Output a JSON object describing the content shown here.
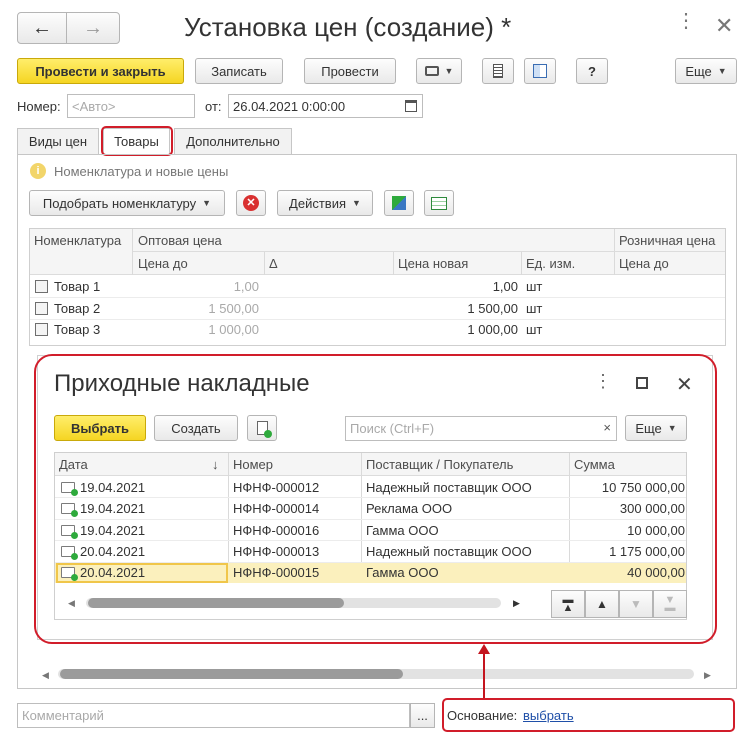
{
  "window": {
    "title": "Установка цен (создание) *"
  },
  "nav": {
    "back_icon": "arrow-left-icon",
    "forward_icon": "arrow-right-icon"
  },
  "toolbar": {
    "post_close": "Провести и закрыть",
    "save": "Записать",
    "post": "Провести",
    "help": "?",
    "more": "Еще"
  },
  "header_fields": {
    "number_label": "Номер:",
    "number_placeholder": "<Авто>",
    "date_label": "от:",
    "date_value": "26.04.2021  0:00:00"
  },
  "tabs": [
    {
      "label": "Виды цен"
    },
    {
      "label": "Товары"
    },
    {
      "label": "Дополнительно"
    }
  ],
  "info_text": "Номенклатура и новые цены",
  "goods_toolbar": {
    "select_items": "Подобрать номенклатуру",
    "actions": "Действия"
  },
  "goods_table": {
    "col_item": "Номенклатура",
    "col_wholesale": "Оптовая цена",
    "col_retail": "Розничная цена",
    "sub_price_before": "Цена до",
    "sub_delta": "Δ",
    "sub_price_new": "Цена новая",
    "sub_unit": "Ед. изм.",
    "sub_retail_before": "Цена до",
    "rows": [
      {
        "name": "Товар 1",
        "before": "1,00",
        "new": "1,00",
        "unit": "шт"
      },
      {
        "name": "Товар 2",
        "before": "1 500,00",
        "new": "1 500,00",
        "unit": "шт"
      },
      {
        "name": "Товар 3",
        "before": "1 000,00",
        "new": "1 000,00",
        "unit": "шт"
      }
    ]
  },
  "popup": {
    "title": "Приходные накладные",
    "choose": "Выбрать",
    "create": "Создать",
    "search_placeholder": "Поиск (Ctrl+F)",
    "clear": "×",
    "more": "Еще",
    "columns": {
      "date": "Дата",
      "sort_arrow": "↓",
      "number": "Номер",
      "counterparty": "Поставщик / Покупатель",
      "sum": "Сумма"
    },
    "rows": [
      {
        "date": "19.04.2021",
        "number": "НФНФ-000012",
        "party": "Надежный поставщик ООО",
        "sum": "10 750 000,00"
      },
      {
        "date": "19.04.2021",
        "number": "НФНФ-000014",
        "party": "Реклама ООО",
        "sum": "300 000,00"
      },
      {
        "date": "19.04.2021",
        "number": "НФНФ-000016",
        "party": "Гамма ООО",
        "sum": "10 000,00"
      },
      {
        "date": "20.04.2021",
        "number": "НФНФ-000013",
        "party": "Надежный поставщик ООО",
        "sum": "1 175 000,00"
      },
      {
        "date": "20.04.2021",
        "number": "НФНФ-000015",
        "party": "Гамма ООО",
        "sum": "40 000,00"
      }
    ],
    "selected_row_color": "#fbf0bd"
  },
  "footer": {
    "comment_placeholder": "Комментарий",
    "ellipsis": "...",
    "basis_label": "Основание:",
    "basis_link": "выбрать"
  },
  "colors": {
    "accent_yellow": "#f5d522",
    "highlight_red": "#d11d2a",
    "link_blue": "#1f4fa8"
  }
}
